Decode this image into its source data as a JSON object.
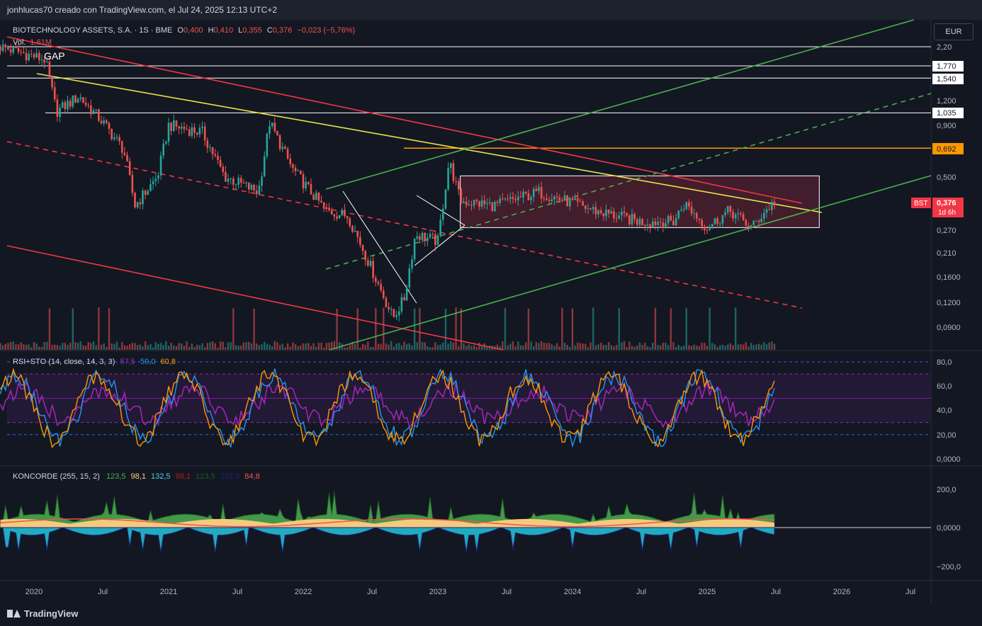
{
  "header": {
    "text": "jonhlucas70 creado con TradingView.com, el Jul 24, 2025 12:13 UTC+2"
  },
  "legend": {
    "symbol": "BIOTECHNOLOGY ASSETS, S.A. · 1S · BME",
    "o_label": "O",
    "o": "0,400",
    "h_label": "H",
    "h": "0,410",
    "l_label": "L",
    "l": "0,355",
    "c_label": "C",
    "c": "0,376",
    "change": "−0,023 (−5,76%)",
    "vol_label": "Vol.",
    "vol": "1,61M",
    "gap_note": "GAP"
  },
  "currency": "EUR",
  "price_axis": {
    "ticks": [
      "2,20",
      "1,200",
      "0,900",
      "0,500",
      "0,270",
      "0,210",
      "0,1600",
      "0,1200",
      "0,0900"
    ],
    "level_labels": [
      "1,770",
      "1,540",
      "1,035"
    ],
    "orange_level": "0,692",
    "current_symbol": "BST",
    "current_price": "0,376",
    "countdown": "1d 6h"
  },
  "time_axis": [
    "2020",
    "Jul",
    "2021",
    "Jul",
    "2022",
    "Jul",
    "2023",
    "Jul",
    "2024",
    "Jul",
    "2025",
    "Jul",
    "2026",
    "Jul"
  ],
  "rsi_panel": {
    "label": "RSI+STO (14, close, 14, 3, 3)",
    "v1": "57,5",
    "v2": "59,0",
    "v3": "60,8",
    "ticks": [
      "80,0",
      "60,0",
      "40,0",
      "20,00",
      "0,0000"
    ]
  },
  "koncorde_panel": {
    "label": "KONCORDE (255, 15, 2)",
    "values": [
      "123,5",
      "98,1",
      "132,5",
      "98,1",
      "123,5",
      "132,5",
      "84,8"
    ],
    "ticks": [
      "200,0",
      "0,0000",
      "−200,0"
    ]
  },
  "footer": {
    "brand": "TradingView"
  },
  "colors": {
    "bull": "#26a69a",
    "bear": "#ef5350",
    "red_line": "#f23645",
    "yellow": "#e8e347",
    "orange": "#ff9800",
    "green_line": "#4caf50",
    "box": "#5c2033",
    "rsi_purple": "#9c27b0",
    "sto_blue": "#2196f3",
    "sto_orange": "#ff9800"
  },
  "chart_data": {
    "type": "candlestick",
    "price_axis_scale": "log",
    "time_range": [
      "2019-10",
      "2026-10"
    ],
    "price_range": [
      0.075,
      2.5
    ],
    "weekly_close_anchors": [
      {
        "date": "2019-10",
        "close": 2.2
      },
      {
        "date": "2020-02",
        "close": 1.9
      },
      {
        "date": "2020-03",
        "close": 1.05
      },
      {
        "date": "2020-05",
        "close": 1.25
      },
      {
        "date": "2020-07",
        "close": 0.95
      },
      {
        "date": "2020-09",
        "close": 0.68
      },
      {
        "date": "2020-10",
        "close": 0.36
      },
      {
        "date": "2020-12",
        "close": 0.5
      },
      {
        "date": "2021-01",
        "close": 0.9
      },
      {
        "date": "2021-04",
        "close": 0.83
      },
      {
        "date": "2021-06",
        "close": 0.5
      },
      {
        "date": "2021-09",
        "close": 0.42
      },
      {
        "date": "2021-10",
        "close": 0.93
      },
      {
        "date": "2021-12",
        "close": 0.55
      },
      {
        "date": "2022-03",
        "close": 0.34
      },
      {
        "date": "2022-05",
        "close": 0.32
      },
      {
        "date": "2022-07",
        "close": 0.18
      },
      {
        "date": "2022-09",
        "close": 0.1
      },
      {
        "date": "2022-10",
        "close": 0.125
      },
      {
        "date": "2022-11",
        "close": 0.26
      },
      {
        "date": "2023-01",
        "close": 0.24
      },
      {
        "date": "2023-02",
        "close": 0.6
      },
      {
        "date": "2023-03",
        "close": 0.38
      },
      {
        "date": "2023-06",
        "close": 0.36
      },
      {
        "date": "2023-10",
        "close": 0.42
      },
      {
        "date": "2024-03",
        "close": 0.34
      },
      {
        "date": "2024-07",
        "close": 0.3
      },
      {
        "date": "2024-10",
        "close": 0.3
      },
      {
        "date": "2024-11",
        "close": 0.37
      },
      {
        "date": "2025-01",
        "close": 0.28
      },
      {
        "date": "2025-03",
        "close": 0.34
      },
      {
        "date": "2025-05",
        "close": 0.28
      },
      {
        "date": "2025-06",
        "close": 0.33
      },
      {
        "date": "2025-07",
        "close": 0.376
      }
    ],
    "horizontal_levels": [
      2.2,
      1.77,
      1.54,
      1.035,
      0.692
    ],
    "consolidation_box": {
      "from": "2023-03",
      "to": "2025-11",
      "high": 0.505,
      "low": 0.28
    }
  }
}
